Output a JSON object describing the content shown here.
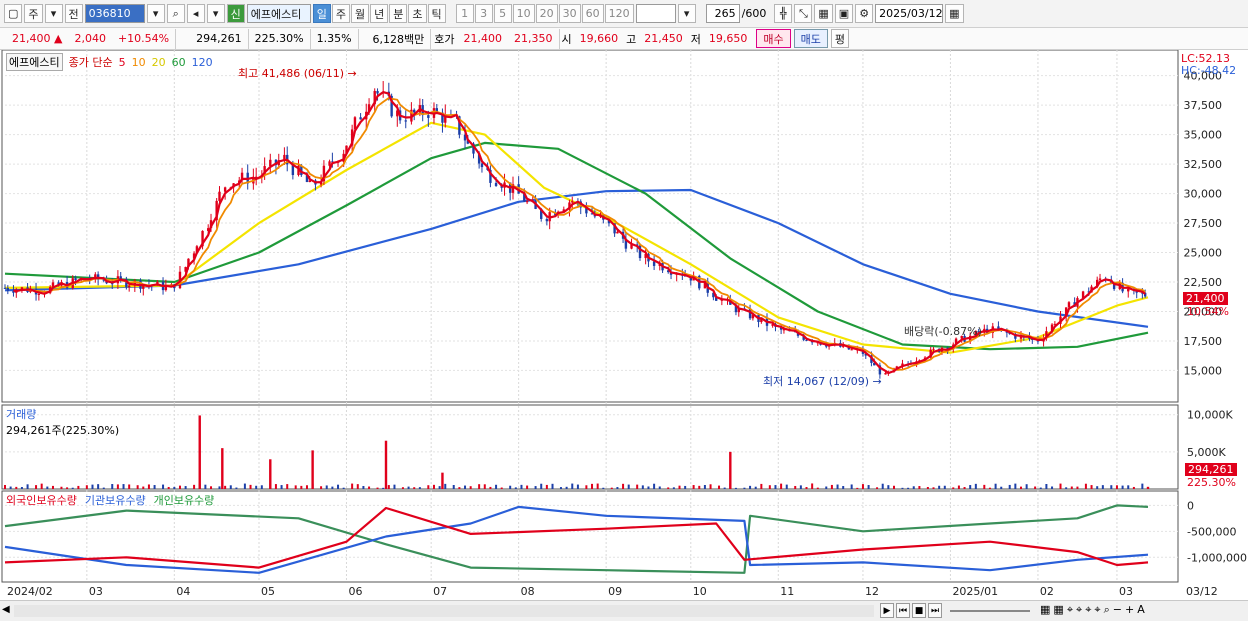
{
  "toolbar": {
    "type_label": "주",
    "prev_label": "전",
    "code": "036810",
    "new_badge": "신",
    "name": "에프에스티",
    "periods": [
      "일",
      "주",
      "월",
      "년",
      "분",
      "초",
      "틱"
    ],
    "active_period": "일",
    "intervals": [
      "1",
      "3",
      "5",
      "10",
      "20",
      "30",
      "60",
      "120"
    ],
    "count": "265",
    "total": "/600",
    "date": "2025/03/12"
  },
  "quote": {
    "price": "21,400",
    "change": "2,040",
    "change_pct": "+10.54%",
    "volume": "294,261",
    "volume_ratio": "225.30%",
    "turnover": "1.35%",
    "amount": "6,128백만",
    "hoga_label": "호가",
    "ask": "21,400",
    "bid": "21,350",
    "open_label": "시",
    "open": "19,660",
    "high_label": "고",
    "high": "21,450",
    "low_label": "저",
    "low": "19,650",
    "buy_label": "매수",
    "sell_label": "매도",
    "eval_label": "평"
  },
  "price_panel": {
    "name": "에프에스티",
    "ma_label": "종가 단순",
    "ma_periods": [
      "5",
      "10",
      "20",
      "60",
      "120"
    ],
    "lc": "LC:52.13",
    "hc": "HC:-48.42",
    "y_ticks": [
      "40,000",
      "37,500",
      "35,000",
      "32,500",
      "30,000",
      "27,500",
      "25,000",
      "22,500",
      "20,000",
      "17,500",
      "15,000"
    ],
    "last_price_tag": "21,400",
    "last_pct_tag": "10.54%",
    "high_note": "최고 41,486 (06/11)",
    "low_note": "최저 14,067 (12/09)",
    "dividend_note": "배당락(-0.87%)"
  },
  "volume_panel": {
    "title": "거래량",
    "subtitle": "294,261주(225.30%)",
    "y_ticks": [
      "10,000K",
      "5,000K"
    ],
    "last_tag": "294,261",
    "last_pct": "225.30%"
  },
  "holding_panel": {
    "series": [
      "외국인보유수량",
      "기관보유수량",
      "개인보유수량"
    ],
    "y_ticks": [
      "0",
      "-500,000",
      "-1,000,000"
    ]
  },
  "x_axis": [
    "2024/02",
    "03",
    "04",
    "05",
    "06",
    "07",
    "08",
    "09",
    "10",
    "11",
    "12",
    "2025/01",
    "02",
    "03",
    "03/12"
  ],
  "chart_data": {
    "type": "line",
    "ma_colors": {
      "ma5": "#e0001b",
      "ma10": "#f08a00",
      "ma20": "#f4e400",
      "ma60": "#1f9a3a",
      "ma120": "#2a5fd8"
    },
    "price_ylim": [
      13000,
      41500
    ],
    "close_series": {
      "name": "종가",
      "points": [
        [
          "2024-02-01",
          22000
        ],
        [
          "2024-02-15",
          21800
        ],
        [
          "2024-03-01",
          22800
        ],
        [
          "2024-03-15",
          22500
        ],
        [
          "2024-04-01",
          22000
        ],
        [
          "2024-04-10",
          26000
        ],
        [
          "2024-04-20",
          31000
        ],
        [
          "2024-05-01",
          31500
        ],
        [
          "2024-05-10",
          33000
        ],
        [
          "2024-05-20",
          30500
        ],
        [
          "2024-06-01",
          34000
        ],
        [
          "2024-06-11",
          39000
        ],
        [
          "2024-06-20",
          36500
        ],
        [
          "2024-07-01",
          37000
        ],
        [
          "2024-07-10",
          36000
        ],
        [
          "2024-07-20",
          32000
        ],
        [
          "2024-08-01",
          30000
        ],
        [
          "2024-08-10",
          28000
        ],
        [
          "2024-08-20",
          29500
        ],
        [
          "2024-09-01",
          27500
        ],
        [
          "2024-09-15",
          24500
        ],
        [
          "2024-10-01",
          23000
        ],
        [
          "2024-10-15",
          20500
        ],
        [
          "2024-11-01",
          18500
        ],
        [
          "2024-11-15",
          17500
        ],
        [
          "2024-12-01",
          16500
        ],
        [
          "2024-12-09",
          14500
        ],
        [
          "2024-12-20",
          16000
        ],
        [
          "2025-01-01",
          17200
        ],
        [
          "2025-01-15",
          18500
        ],
        [
          "2025-02-01",
          17500
        ],
        [
          "2025-02-15",
          21000
        ],
        [
          "2025-02-25",
          23000
        ],
        [
          "2025-03-05",
          21500
        ],
        [
          "2025-03-12",
          21400
        ]
      ]
    },
    "ma120_series": {
      "name": "120",
      "points": [
        [
          "2024-02-01",
          21800
        ],
        [
          "2024-04-01",
          22200
        ],
        [
          "2024-05-15",
          24000
        ],
        [
          "2024-07-01",
          27000
        ],
        [
          "2024-08-01",
          29300
        ],
        [
          "2024-09-01",
          30200
        ],
        [
          "2024-10-01",
          30300
        ],
        [
          "2024-11-01",
          27500
        ],
        [
          "2024-12-01",
          24000
        ],
        [
          "2025-01-01",
          21500
        ],
        [
          "2025-02-01",
          20000
        ],
        [
          "2025-03-12",
          18700
        ]
      ]
    },
    "ma60_series": {
      "name": "60",
      "points": [
        [
          "2024-02-01",
          23200
        ],
        [
          "2024-04-01",
          22500
        ],
        [
          "2024-05-01",
          25000
        ],
        [
          "2024-06-01",
          29000
        ],
        [
          "2024-07-01",
          33000
        ],
        [
          "2024-07-20",
          34300
        ],
        [
          "2024-08-15",
          33800
        ],
        [
          "2024-09-15",
          30000
        ],
        [
          "2024-10-15",
          24500
        ],
        [
          "2024-11-15",
          20000
        ],
        [
          "2024-12-15",
          17200
        ],
        [
          "2025-01-15",
          16800
        ],
        [
          "2025-02-15",
          17000
        ],
        [
          "2025-03-12",
          18200
        ]
      ]
    },
    "ma20_series": {
      "name": "20",
      "points": [
        [
          "2024-02-01",
          22000
        ],
        [
          "2024-04-01",
          22200
        ],
        [
          "2024-05-01",
          27500
        ],
        [
          "2024-06-01",
          32000
        ],
        [
          "2024-07-01",
          36000
        ],
        [
          "2024-07-20",
          35000
        ],
        [
          "2024-08-10",
          30500
        ],
        [
          "2024-09-01",
          28000
        ],
        [
          "2024-10-01",
          24000
        ],
        [
          "2024-11-01",
          19500
        ],
        [
          "2024-12-01",
          17200
        ],
        [
          "2025-01-01",
          16500
        ],
        [
          "2025-02-01",
          17800
        ],
        [
          "2025-03-01",
          20500
        ],
        [
          "2025-03-12",
          21200
        ]
      ]
    },
    "volume_bars": [
      [
        "2024-04-10",
        9900
      ],
      [
        "2024-04-18",
        5500
      ],
      [
        "2024-05-05",
        4000
      ],
      [
        "2024-05-20",
        5200
      ],
      [
        "2024-06-15",
        6500
      ],
      [
        "2024-07-05",
        2200
      ],
      [
        "2024-10-15",
        5000
      ],
      [
        "2025-03-12",
        294
      ]
    ],
    "holding_ylim": [
      -1400000,
      200000
    ],
    "foreign_holding": [
      [
        "2024-02-01",
        -1100000
      ],
      [
        "2024-03-15",
        -1000000
      ],
      [
        "2024-05-01",
        -1200000
      ],
      [
        "2024-06-01",
        -700000
      ],
      [
        "2024-06-15",
        -50000
      ],
      [
        "2024-07-15",
        -550000
      ],
      [
        "2024-09-01",
        -450000
      ],
      [
        "2024-10-10",
        -350000
      ],
      [
        "2024-10-20",
        -1050000
      ],
      [
        "2024-12-01",
        -850000
      ],
      [
        "2025-01-15",
        -700000
      ],
      [
        "2025-02-15",
        -900000
      ],
      [
        "2025-03-01",
        -1150000
      ],
      [
        "2025-03-12",
        -1100000
      ]
    ],
    "institution_holding": [
      [
        "2024-02-01",
        -800000
      ],
      [
        "2024-03-15",
        -1150000
      ],
      [
        "2024-05-01",
        -1300000
      ],
      [
        "2024-06-15",
        -600000
      ],
      [
        "2024-07-15",
        -350000
      ],
      [
        "2024-08-01",
        -30000
      ],
      [
        "2024-09-01",
        -200000
      ],
      [
        "2024-10-20",
        -300000
      ],
      [
        "2024-10-22",
        -1150000
      ],
      [
        "2024-12-01",
        -1100000
      ],
      [
        "2025-01-15",
        -1250000
      ],
      [
        "2025-02-15",
        -1050000
      ],
      [
        "2025-03-12",
        -950000
      ]
    ],
    "individual_holding": [
      [
        "2024-02-01",
        -400000
      ],
      [
        "2024-03-15",
        -100000
      ],
      [
        "2024-05-15",
        -250000
      ],
      [
        "2024-06-15",
        -750000
      ],
      [
        "2024-07-15",
        -1200000
      ],
      [
        "2024-09-01",
        -1250000
      ],
      [
        "2024-10-20",
        -1300000
      ],
      [
        "2024-10-22",
        -200000
      ],
      [
        "2024-12-01",
        -500000
      ],
      [
        "2025-01-15",
        -350000
      ],
      [
        "2025-02-15",
        -250000
      ],
      [
        "2025-03-01",
        0
      ],
      [
        "2025-03-12",
        -30000
      ]
    ]
  }
}
